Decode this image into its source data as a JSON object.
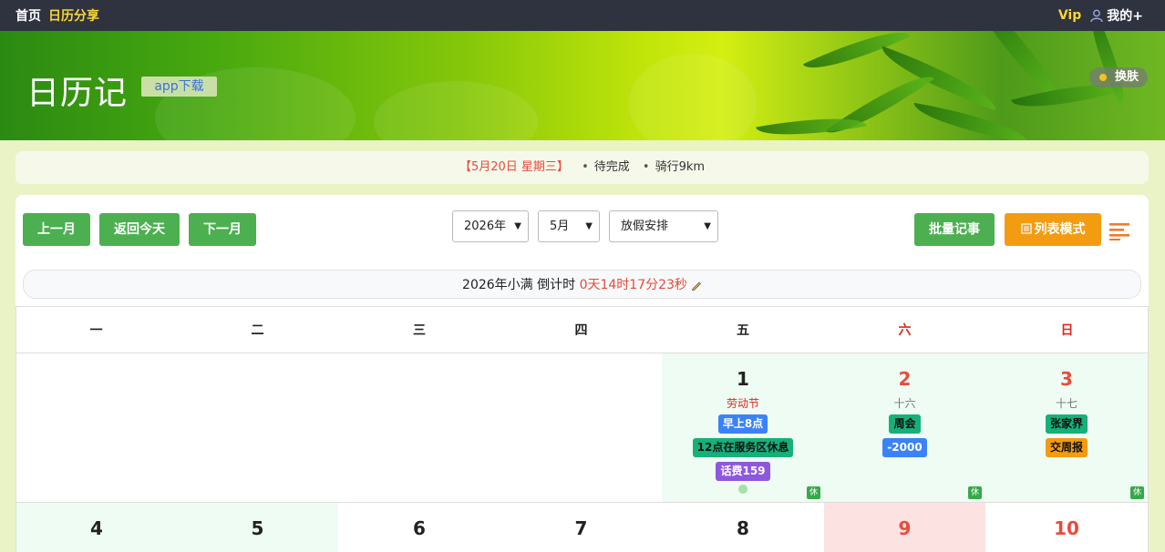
{
  "nav": {
    "home": "首页",
    "share": "日历分享",
    "vip": "Vip",
    "mine": "我的+"
  },
  "banner": {
    "title": "日历记",
    "app_download": "app下载",
    "skin": "换肤"
  },
  "notice": {
    "date": "【5月20日 星期三】",
    "item1": "待完成",
    "item2": "骑行9km"
  },
  "toolbar": {
    "prev_month": "上一月",
    "today": "返回今天",
    "next_month": "下一月",
    "year": "2026年",
    "month": "5月",
    "holiday": "放假安排",
    "batch": "批量记事",
    "list_mode": "列表模式"
  },
  "countdown": {
    "label": "2026年小满 倒计时 ",
    "time": "0天14时17分23秒"
  },
  "weekdays": [
    "一",
    "二",
    "三",
    "四",
    "五",
    "六",
    "日"
  ],
  "days": {
    "d1": {
      "num": "1",
      "sub": "劳动节",
      "tags": [
        "早上8点",
        "12点在服务区休息",
        "话费159"
      ],
      "rest": "休"
    },
    "d2": {
      "num": "2",
      "sub": "十六",
      "tags": [
        "周会",
        "-2000"
      ],
      "rest": "休"
    },
    "d3": {
      "num": "3",
      "sub": "十七",
      "tags": [
        "张家界",
        "交周报"
      ],
      "rest": "休"
    },
    "d4": {
      "num": "4"
    },
    "d5": {
      "num": "5"
    },
    "d6": {
      "num": "6"
    },
    "d7": {
      "num": "7"
    },
    "d8": {
      "num": "8"
    },
    "d9": {
      "num": "9"
    },
    "d10": {
      "num": "10"
    }
  },
  "colors": {
    "nav_bg": "#2f3340",
    "accent_green": "#4caf50",
    "accent_orange": "#f39c12",
    "red": "#e74c3c",
    "weekend_bg": "#eefcf3",
    "highlight_bg": "#fde2e2"
  }
}
